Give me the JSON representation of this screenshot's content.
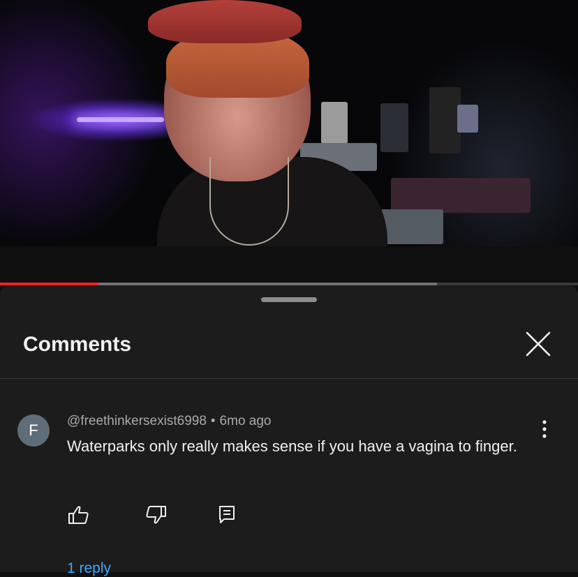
{
  "player": {
    "progress_played": 0.17,
    "progress_buffered": 0.756
  },
  "comments": {
    "title": "Comments",
    "close_icon": "close-icon"
  },
  "comment": {
    "avatar_letter": "F",
    "author": "@freethinkersexist6998",
    "separator": "•",
    "time": "6mo ago",
    "text": "Waterparks only really makes sense if you have a vagina to finger.",
    "reply_link": "1 reply"
  },
  "icons": {
    "like": "thumbs-up-icon",
    "dislike": "thumbs-down-icon",
    "reply": "comment-reply-icon",
    "menu": "more-vertical-icon"
  },
  "colors": {
    "background": "#0f0f0f",
    "sheet": "#1c1c1c",
    "progress": "#ff2020",
    "link": "#3ea6ff"
  }
}
